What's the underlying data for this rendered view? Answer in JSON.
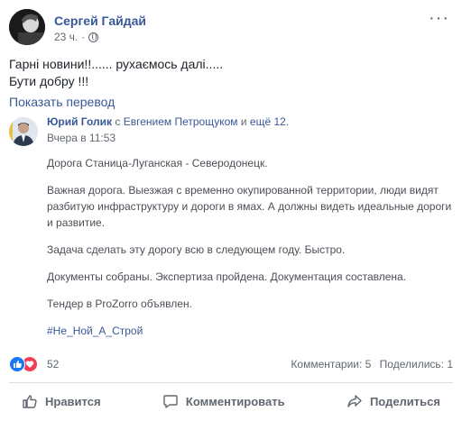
{
  "post": {
    "author": "Сергей Гайдай",
    "time": "23 ч.",
    "privacy_icon": "globe-icon",
    "more_label": "···",
    "text_line1": "Гарні новини!!...... рухаємось далі.....",
    "text_line2": "Бути добру !!!",
    "translate_label": "Показать перевод"
  },
  "shared": {
    "author": "Юрий Голик",
    "with_text": " с ",
    "tagged_person": "Евгением Петрощуком",
    "and_text": " и ",
    "others": "ещё 12",
    "period": ".",
    "time": "Вчера в 11:53",
    "paragraphs": [
      "Дорога Станица-Луганская - Северодонецк.",
      "Важная дорога. Выезжая с временно окупированной территории, люди видят разбитую инфраструктуру и дороги в ямах. А должны видеть идеальные дороги и развитие.",
      "Задача сделать эту дорогу всю в следующем году. Быстро.",
      "Документы собраны. Экспертиза пройдена. Документация составлена.",
      "Тендер в ProZorro объявлен."
    ],
    "hashtag": "#Не_Ной_А_Строй"
  },
  "reactions": {
    "count": "52",
    "comments": "Комментарии: 5",
    "shares": "Поделились: 1",
    "colors": {
      "like": "#1877f2",
      "love": "#f33e58"
    }
  },
  "actions": {
    "like": "Нравится",
    "comment": "Комментировать",
    "share": "Поделиться"
  }
}
